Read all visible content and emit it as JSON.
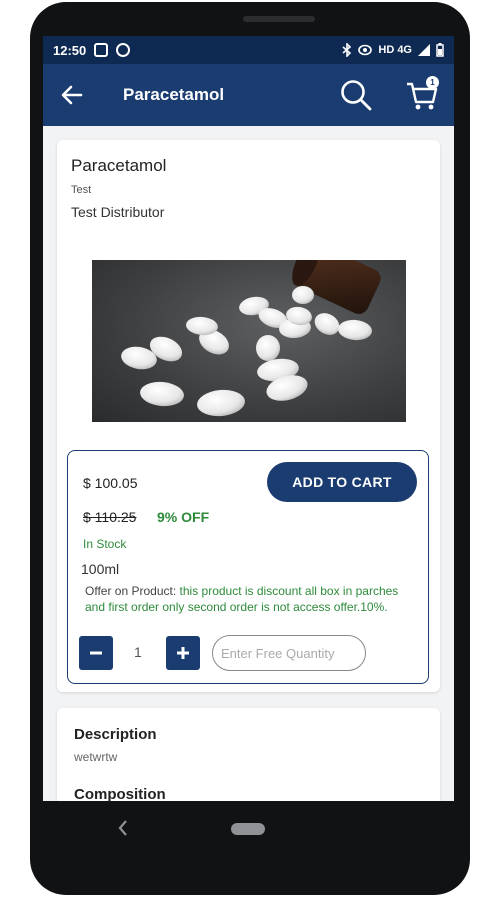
{
  "status_bar": {
    "time": "12:50",
    "network": "HD 4G",
    "icons": [
      "image-icon",
      "vpn-icon",
      "bluetooth-icon",
      "eye-icon",
      "signal-icon",
      "battery-icon"
    ]
  },
  "app_bar": {
    "title": "Paracetamol",
    "cart_count": "1",
    "icons": [
      "back-arrow-icon",
      "search-icon",
      "cart-icon"
    ]
  },
  "product": {
    "name": "Paracetamol",
    "company": "Test",
    "distributor": "Test Distributor",
    "price": "$ 100.05",
    "mrp": "$ 110.25",
    "discount": "9% OFF",
    "stock_status": "In Stock",
    "pack_size": "100ml",
    "offer_label": "Offer on Product:",
    "offer_text": "this product is discount all box in parches and first order only second order is not access offer.10%.",
    "add_to_cart_label": "ADD TO CART",
    "quantity": "1",
    "free_quantity_placeholder": "Enter Free Quantity"
  },
  "details": {
    "description_heading": "Description",
    "description_text": "wetwrtw",
    "composition_heading": "Composition"
  },
  "colors": {
    "primary": "#1a3c70",
    "status_bar": "#0e2a52",
    "discount_green": "#2e8b3b",
    "background": "#f2f3f5"
  }
}
